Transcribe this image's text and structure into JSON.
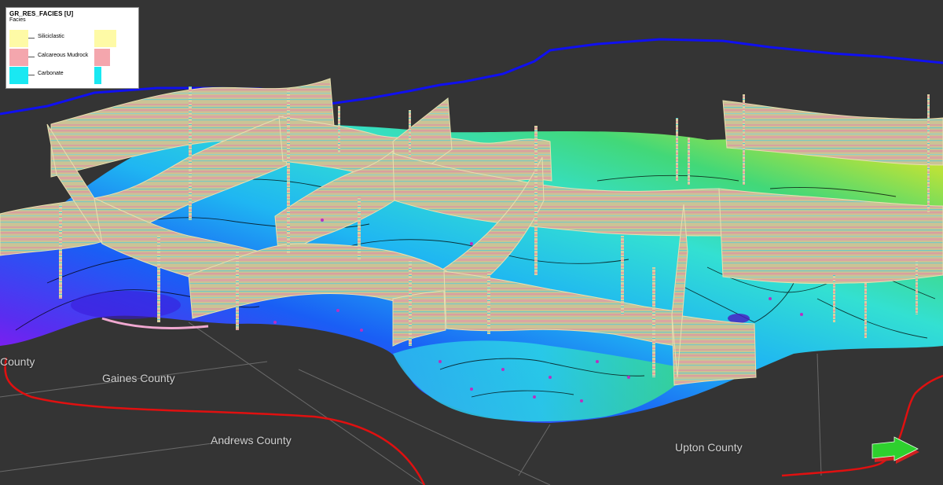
{
  "legend": {
    "title": "GR_RES_FACIES [U]",
    "subtitle": "Facies",
    "items": [
      {
        "label": "Siliciclastic",
        "color": "#fefaa6",
        "share": 1.0
      },
      {
        "label": "Calcareous Mudrock",
        "color": "#f4a6ad",
        "share": 0.72
      },
      {
        "label": "Carbonate",
        "color": "#19e8f2",
        "share": 0.32
      }
    ]
  },
  "map": {
    "counties": [
      {
        "label": "County"
      },
      {
        "label": "Gaines County"
      },
      {
        "label": "Andrews County"
      },
      {
        "label": "Upton County"
      }
    ],
    "colors": {
      "background": "#343434",
      "county_boundary": "#e01010",
      "state_boundary": "#1010f0",
      "grid_lines": "#6a6a6a",
      "fence_base": "#c9c190"
    }
  }
}
